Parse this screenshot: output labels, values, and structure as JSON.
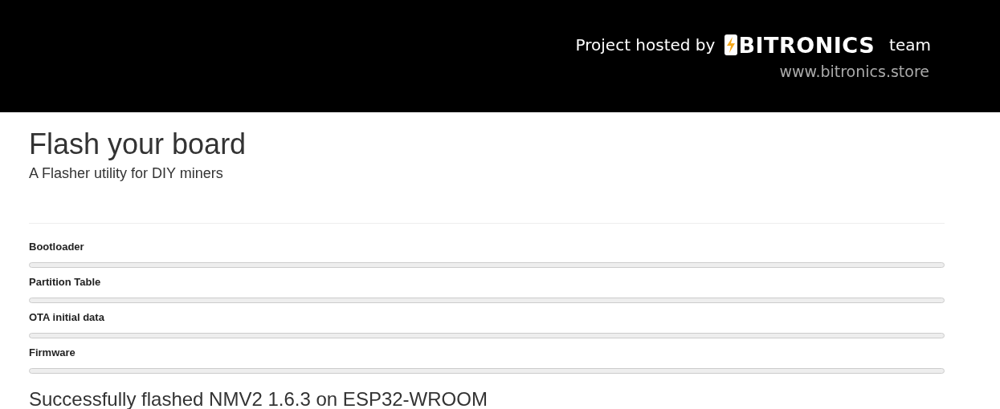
{
  "header": {
    "hosted_text": "Project hosted by",
    "logo_text": "BITRONICS",
    "team_text": "team",
    "website": "www.bitronics.store"
  },
  "page": {
    "title": "Flash your board",
    "subtitle": "A Flasher utility for DIY miners"
  },
  "progress": [
    {
      "label": "Bootloader",
      "level": 0
    },
    {
      "label": "Partition Table",
      "level": 0
    },
    {
      "label": "OTA initial data",
      "level": 0
    },
    {
      "label": "Firmware",
      "level": 0
    }
  ],
  "status": "Successfully flashed NMV2 1.6.3 on ESP32-WROOM"
}
